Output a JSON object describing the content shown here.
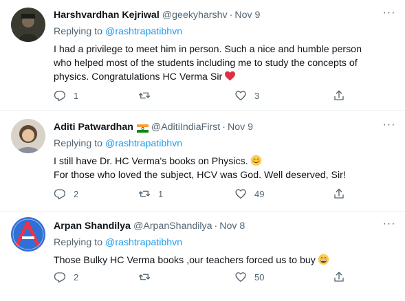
{
  "tweets": [
    {
      "name": "Harshvardhan Kejriwal",
      "handle": "@geekyharshv",
      "dot": "·",
      "date": "Nov 9",
      "replying_prefix": "Replying to ",
      "replying_to": "@rashtrapatibhvn",
      "lines": [
        "I had a privilege to meet him in person. Such a nice and humble person",
        "who helped most of the students including me to study the concepts of",
        "physics. Congratulations HC Verma Sir"
      ],
      "emoji": "red-heart",
      "replies": "1",
      "retweets": "",
      "likes": "3"
    },
    {
      "name": "Aditi Patwardhan",
      "handle": "@AditiIndiaFirst",
      "dot": "·",
      "date": "Nov 9",
      "flag": "india-flag",
      "replying_prefix": "Replying to ",
      "replying_to": "@rashtrapatibhvn",
      "lines": [
        "I still have Dr. HC Verma's books on Physics.",
        "For those who loved the subject, HCV was God. Well deserved, Sir!"
      ],
      "emoji": "smiling-face",
      "replies": "2",
      "retweets": "1",
      "likes": "49"
    },
    {
      "name": "Arpan Shandilya",
      "handle": "@ArpanShandilya",
      "dot": "·",
      "date": "Nov 8",
      "replying_prefix": "Replying to ",
      "replying_to": "@rashtrapatibhvn",
      "lines": [
        "Those Bulky HC Verma books ,our teachers forced us to buy"
      ],
      "emoji": "grinning-face",
      "replies": "2",
      "retweets": "",
      "likes": "50"
    }
  ],
  "more_label": "···",
  "colors": {
    "text": "#0f1419",
    "secondary": "#536471",
    "link": "#1d9bf0",
    "heart": "#f91880"
  }
}
